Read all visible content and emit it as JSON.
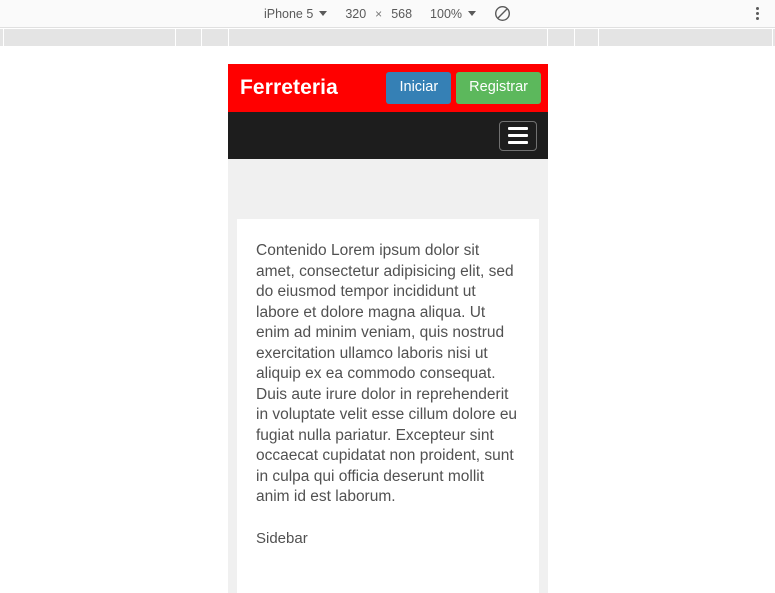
{
  "toolbar": {
    "device_label": "iPhone 5",
    "width_value": "320",
    "times_symbol": "×",
    "height_value": "568",
    "zoom_label": "100%",
    "throttle_icon": "no-throttling-icon",
    "menu_icon": "more-vertical-icon"
  },
  "ruler": {
    "ticks": [
      175,
      200,
      228,
      547,
      574,
      598
    ]
  },
  "page": {
    "header": {
      "brand": "Ferreteria",
      "login_button": "Iniciar",
      "register_button": "Registrar"
    },
    "navbar": {
      "toggle_icon": "hamburger-menu-icon"
    },
    "content": {
      "lead": "Contenido Lorem ipsum dolor sit amet, consectetur adipisicing elit, sed do eiusmod tempor incididunt ut labore et dolore magna aliqua. Ut enim ad minim veniam, quis nostrud exercitation ullamco laboris nisi ut aliquip ex ea commodo consequat. Duis aute irure dolor in reprehenderit in voluptate velit esse cillum dolore eu fugiat nulla pariatur. Excepteur sint occaecat cupidatat non proident, sunt in culpa qui officia deserunt mollit anim id est laborum.",
      "sidebar": "Sidebar"
    }
  },
  "colors": {
    "header_red": "#ff0000",
    "navbar_dark": "#1d1d1d",
    "primary_blue": "#3580b5",
    "success_green": "#5cb85c",
    "band_grey": "#f0f0f0"
  }
}
